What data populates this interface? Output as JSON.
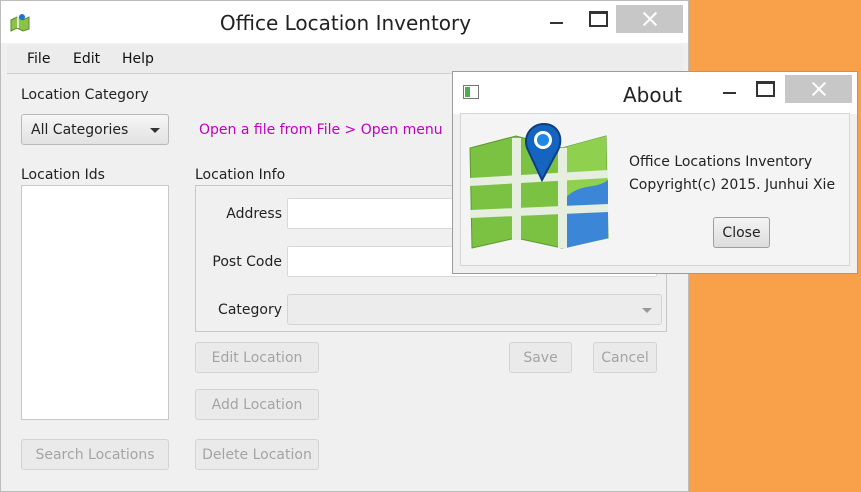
{
  "main_window": {
    "title": "Office Location Inventory",
    "menu": [
      "File",
      "Edit",
      "Help"
    ],
    "location_category_label": "Location Category",
    "category_selected": "All Categories",
    "hint": "Open a file from File > Open menu",
    "location_ids_label": "Location Ids",
    "location_info_label": "Location Info",
    "fields": {
      "address_label": "Address",
      "address_value": "",
      "postcode_label": "Post Code",
      "postcode_value": "",
      "category_label": "Category",
      "category_value": ""
    },
    "buttons": {
      "edit": "Edit Location",
      "save": "Save",
      "cancel": "Cancel",
      "add": "Add Location",
      "search": "Search Locations",
      "delete": "Delete Location"
    }
  },
  "about_dialog": {
    "title": "About",
    "line1": "Office Locations Inventory",
    "line2": "Copyright(c) 2015. Junhui Xie",
    "close_label": "Close"
  },
  "icons": {
    "app": "map-app-icon",
    "about_window": "window-icon",
    "about_image": "map-pin-icon"
  },
  "colors": {
    "desktop": "#f9a04a",
    "hint": "#c000c0",
    "close_button": "#c7c7c7"
  }
}
